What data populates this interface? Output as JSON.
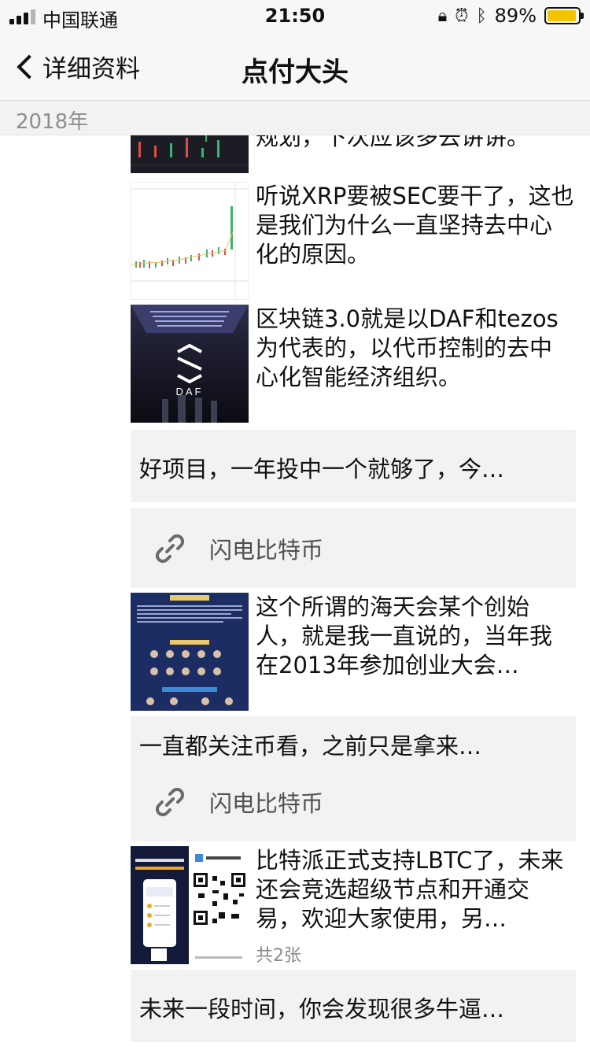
{
  "status_bar": {
    "carrier": "中国联通",
    "time": "21:50",
    "battery": "89%",
    "battery_level": 0.89,
    "signal_bars": 3
  },
  "nav": {
    "back_label": "详细资料",
    "title": "点付大头"
  },
  "year_header": "2018年",
  "posts": [
    {
      "type": "image",
      "text": "规划，下次应该多去讲讲。"
    },
    {
      "type": "image",
      "text": "听说XRP要被SEC要干了，这也是我们为什么一直坚持去中心化的原因。"
    },
    {
      "type": "image",
      "text": "区块链3.0就是以DAF和tezos为代表的，以代币控制的去中心化智能经济组织。",
      "image_text": "DAF"
    },
    {
      "type": "text",
      "text": "好项目，一年投中一个就够了，今…"
    },
    {
      "type": "link",
      "title": "闪电比特币"
    },
    {
      "type": "image",
      "text": "这个所谓的海天会某个创始人，就是我一直说的，当年我在2013年参加创业大会…"
    },
    {
      "type": "text",
      "text": "一直都关注币看，之前只是拿来…"
    },
    {
      "type": "link",
      "title": "闪电比特币"
    },
    {
      "type": "image",
      "text": "比特派正式支持LBTC了，未来还会竞选超级节点和开通交易，欢迎大家使用，另…",
      "count": "共2张"
    },
    {
      "type": "text",
      "text": "未来一段时间，你会发现很多牛逼…"
    }
  ],
  "colors": {
    "nav_background": "#f7f7f7",
    "card_background": "#f2f2f2",
    "battery": "#f5c400"
  }
}
